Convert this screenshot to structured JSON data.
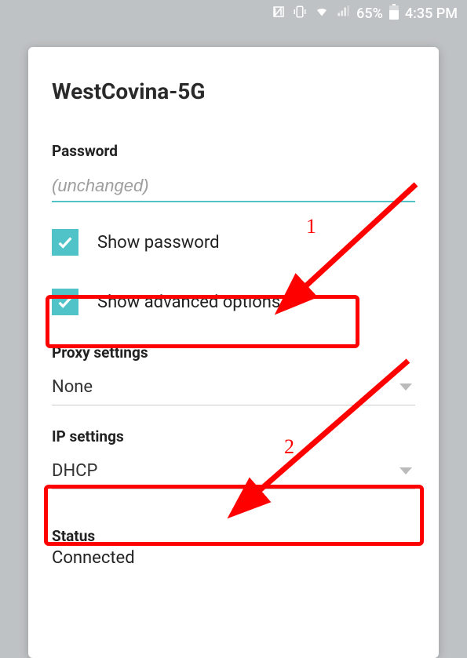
{
  "statusbar": {
    "battery_pct": "65%",
    "time": "4:35 PM"
  },
  "dialog": {
    "network_name": "WestCovina-5G",
    "password_label": "Password",
    "password_placeholder": "(unchanged)",
    "show_password_label": "Show password",
    "show_advanced_label": "Show advanced options",
    "proxy_label": "Proxy settings",
    "proxy_value": "None",
    "ip_label": "IP settings",
    "ip_value": "DHCP",
    "status_label": "Status",
    "status_value": "Connected"
  },
  "annotations": {
    "num1": "1",
    "num2": "2"
  }
}
